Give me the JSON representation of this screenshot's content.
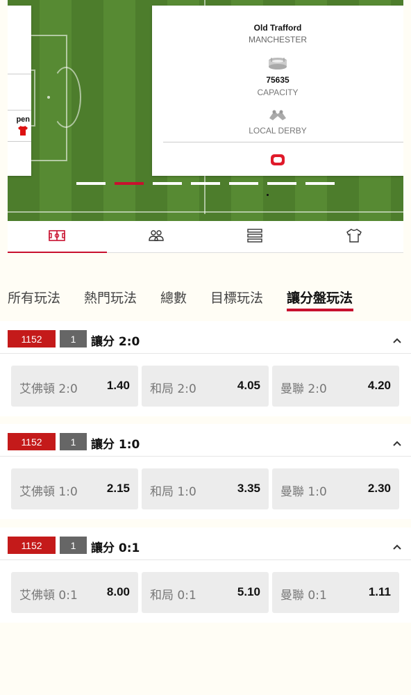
{
  "venue": {
    "left_card_text": "pen",
    "stadium": "Old Trafford",
    "city": "MANCHESTER",
    "capacity": "75635",
    "capacity_label": "CAPACITY",
    "derby_label": "LOCAL DERBY"
  },
  "carousel": {
    "count": 7,
    "active_index": 1
  },
  "icon_tabs": [
    {
      "name": "pitch-icon",
      "active": true
    },
    {
      "name": "players-icon",
      "active": false
    },
    {
      "name": "list-icon",
      "active": false
    },
    {
      "name": "jersey-icon",
      "active": false
    }
  ],
  "market_tabs": [
    "所有玩法",
    "熱門玩法",
    "總數",
    "目標玩法",
    "讓分盤玩法"
  ],
  "active_market_tab": "讓分盤玩法",
  "colors": {
    "accent": "#c8102e",
    "badge_red": "#c41a1a",
    "badge_grey": "#666666",
    "pitch_green": "#4d7d2c"
  },
  "sections": [
    {
      "id_badge": "1152",
      "num_badge": "1",
      "title": "讓分 2:0",
      "odds": [
        {
          "label": "艾佛頓 2:0",
          "value": "1.40"
        },
        {
          "label": "和局 2:0",
          "value": "4.05"
        },
        {
          "label": "曼聯 2:0",
          "value": "4.20"
        }
      ]
    },
    {
      "id_badge": "1152",
      "num_badge": "1",
      "title": "讓分 1:0",
      "odds": [
        {
          "label": "艾佛頓 1:0",
          "value": "2.15"
        },
        {
          "label": "和局 1:0",
          "value": "3.35"
        },
        {
          "label": "曼聯 1:0",
          "value": "2.30"
        }
      ]
    },
    {
      "id_badge": "1152",
      "num_badge": "1",
      "title": "讓分 0:1",
      "odds": [
        {
          "label": "艾佛頓 0:1",
          "value": "8.00"
        },
        {
          "label": "和局 0:1",
          "value": "5.10"
        },
        {
          "label": "曼聯 0:1",
          "value": "1.11"
        }
      ]
    }
  ]
}
